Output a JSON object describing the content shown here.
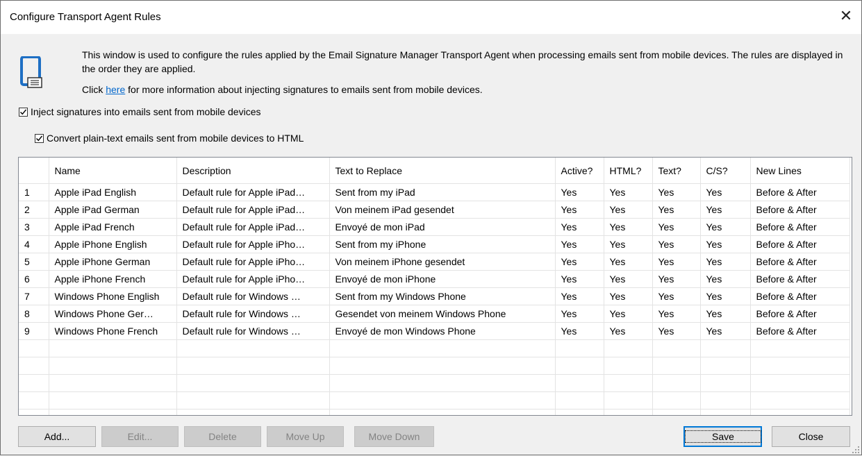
{
  "window": {
    "title": "Configure Transport Agent Rules",
    "close_glyph": "✕"
  },
  "intro": {
    "text": "This window is used to configure the rules applied by the Email Signature Manager Transport Agent when processing emails sent from mobile devices. The rules are displayed in the order they are applied.",
    "link_prefix": "Click ",
    "link_text": "here",
    "link_suffix": " for more information about injecting signatures to emails sent from mobile devices."
  },
  "options": {
    "inject_label": "Inject signatures into emails sent from mobile devices",
    "inject_checked": true,
    "convert_label": "Convert plain-text emails sent from mobile devices to HTML",
    "convert_checked": true
  },
  "table": {
    "columns": [
      "",
      "Name",
      "Description",
      "Text to Replace",
      "Active?",
      "HTML?",
      "Text?",
      "C/S?",
      "New Lines"
    ],
    "rows": [
      [
        "1",
        "Apple iPad English",
        "Default rule for Apple iPad…",
        "Sent from my iPad",
        "Yes",
        "Yes",
        "Yes",
        "Yes",
        "Before & After"
      ],
      [
        "2",
        "Apple iPad German",
        "Default rule for Apple iPad…",
        "Von meinem iPad gesendet",
        "Yes",
        "Yes",
        "Yes",
        "Yes",
        "Before & After"
      ],
      [
        "3",
        "Apple iPad French",
        "Default rule for Apple iPad…",
        "Envoyé de mon iPad",
        "Yes",
        "Yes",
        "Yes",
        "Yes",
        "Before & After"
      ],
      [
        "4",
        "Apple iPhone English",
        "Default rule for Apple iPho…",
        "Sent from my iPhone",
        "Yes",
        "Yes",
        "Yes",
        "Yes",
        "Before & After"
      ],
      [
        "5",
        "Apple iPhone German",
        "Default rule for Apple iPho…",
        "Von meinem iPhone gesendet",
        "Yes",
        "Yes",
        "Yes",
        "Yes",
        "Before & After"
      ],
      [
        "6",
        "Apple iPhone French",
        "Default rule for Apple iPho…",
        "Envoyé de mon iPhone",
        "Yes",
        "Yes",
        "Yes",
        "Yes",
        "Before & After"
      ],
      [
        "7",
        "Windows Phone English",
        "Default rule for Windows …",
        "Sent from my Windows Phone",
        "Yes",
        "Yes",
        "Yes",
        "Yes",
        "Before & After"
      ],
      [
        "8",
        "Windows Phone Ger…",
        "Default rule for Windows …",
        "Gesendet von meinem Windows Phone",
        "Yes",
        "Yes",
        "Yes",
        "Yes",
        "Before & After"
      ],
      [
        "9",
        "Windows Phone French",
        "Default rule for Windows …",
        "Envoyé de mon Windows Phone",
        "Yes",
        "Yes",
        "Yes",
        "Yes",
        "Before & After"
      ]
    ]
  },
  "buttons": {
    "add": "Add...",
    "edit": "Edit...",
    "delete": "Delete",
    "move_up": "Move Up",
    "move_down": "Move Down",
    "save": "Save",
    "close": "Close"
  },
  "colors": {
    "link": "#0066cc",
    "focus_border": "#0078d7",
    "icon_blue": "#1e6fc4"
  },
  "icons": {
    "device": "mobile-device-icon",
    "close": "close-icon"
  }
}
